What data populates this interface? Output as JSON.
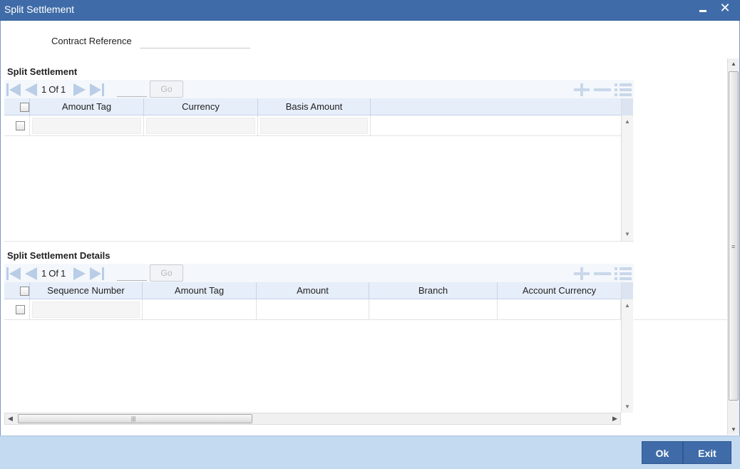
{
  "window": {
    "title": "Split Settlement",
    "minimize_icon": "minimize-icon",
    "close_icon": "close-icon",
    "close_glyph": "✕"
  },
  "contract": {
    "label": "Contract Reference",
    "value": ""
  },
  "split_settlement": {
    "section_title": "Split Settlement",
    "pager": {
      "current": "1",
      "of_label": "Of",
      "total": "1",
      "page_value": "",
      "go_label": "Go"
    },
    "columns": [
      "Amount Tag",
      "Currency",
      "Basis Amount"
    ],
    "rows": [
      {
        "amount_tag": "",
        "currency": "",
        "basis_amount": ""
      }
    ]
  },
  "split_settlement_details": {
    "section_title": "Split Settlement Details",
    "pager": {
      "current": "1",
      "of_label": "Of",
      "total": "1",
      "page_value": "",
      "go_label": "Go"
    },
    "columns": [
      "Sequence Number",
      "Amount Tag",
      "Amount",
      "Branch",
      "Account Currency"
    ],
    "rows": [
      {
        "sequence_number": "",
        "amount_tag": "",
        "amount": "",
        "branch": "",
        "account_currency": ""
      }
    ]
  },
  "footer": {
    "ok_label": "Ok",
    "exit_label": "Exit"
  },
  "colors": {
    "titlebar": "#3f6ca8",
    "footer": "#c3daf0",
    "grid_header": "#e6eefa",
    "button": "#3f6ca8"
  }
}
